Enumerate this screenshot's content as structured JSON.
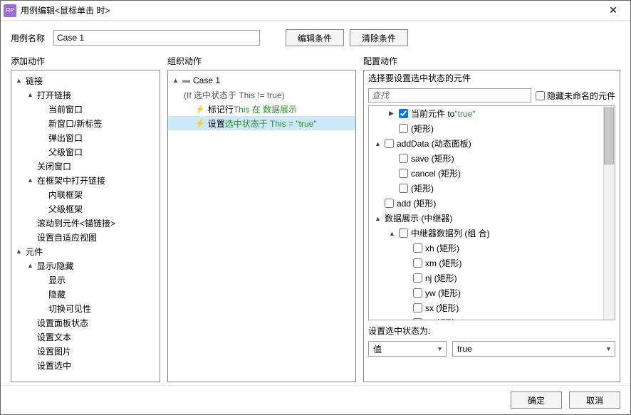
{
  "title": "用例编辑<鼠标单击 时>",
  "caseNameLabel": "用例名称",
  "caseName": "Case 1",
  "btnEditCondition": "编辑条件",
  "btnClearCondition": "清除条件",
  "colAdd": "添加动作",
  "colOrganize": "组织动作",
  "colConfigure": "配置动作",
  "addTree": [
    {
      "label": "链接",
      "level": 0,
      "expanded": true
    },
    {
      "label": "打开链接",
      "level": 1,
      "expanded": true
    },
    {
      "label": "当前窗口",
      "level": 2
    },
    {
      "label": "新窗口/新标签",
      "level": 2
    },
    {
      "label": "弹出窗口",
      "level": 2
    },
    {
      "label": "父级窗口",
      "level": 2
    },
    {
      "label": "关闭窗口",
      "level": 1
    },
    {
      "label": "在框架中打开链接",
      "level": 1,
      "expanded": true
    },
    {
      "label": "内联框架",
      "level": 2
    },
    {
      "label": "父级框架",
      "level": 2
    },
    {
      "label": "滚动到元件<锚链接>",
      "level": 1
    },
    {
      "label": "设置自适应视图",
      "level": 1
    },
    {
      "label": "元件",
      "level": 0,
      "expanded": true
    },
    {
      "label": "显示/隐藏",
      "level": 1,
      "expanded": true
    },
    {
      "label": "显示",
      "level": 2
    },
    {
      "label": "隐藏",
      "level": 2
    },
    {
      "label": "切换可见性",
      "level": 2
    },
    {
      "label": "设置面板状态",
      "level": 1
    },
    {
      "label": "设置文本",
      "level": 1
    },
    {
      "label": "设置图片",
      "level": 1
    },
    {
      "label": "设置选中",
      "level": 1
    }
  ],
  "orgCase": "Case 1",
  "orgCondition": "(If 选中状态于 This != true)",
  "orgAction1_a": "标记行 ",
  "orgAction1_b": "This 在 数据展示",
  "orgAction2_a": "设置 ",
  "orgAction2_b": "选中状态于 This = \"true\"",
  "cfgSelectLabel": "选择要设置选中状态的元件",
  "searchPlaceholder": "查找",
  "hideUnnamed": "隐藏未命名的元件",
  "cfgTree": [
    {
      "label_a": "当前元件 to ",
      "label_b": "\"true\"",
      "level": 1,
      "checked": true,
      "expanded": false
    },
    {
      "label_a": "(矩形)",
      "level": 1
    },
    {
      "label_a": "addData (动态面板)",
      "level": 0,
      "expanded": true
    },
    {
      "label_a": "save (矩形)",
      "level": 1
    },
    {
      "label_a": "cancel (矩形)",
      "level": 1
    },
    {
      "label_a": "(矩形)",
      "level": 1
    },
    {
      "label_a": "add (矩形)",
      "level": 0
    },
    {
      "label_a": "数据展示 (中继器)",
      "level": 0,
      "expanded": true,
      "noCheck": true
    },
    {
      "label_a": "中继器数据列 (组 合)",
      "level": 1,
      "expanded": true
    },
    {
      "label_a": "xh (矩形)",
      "level": 2
    },
    {
      "label_a": "xm (矩形)",
      "level": 2
    },
    {
      "label_a": "nj (矩形)",
      "level": 2
    },
    {
      "label_a": "yw (矩形)",
      "level": 2
    },
    {
      "label_a": "sx (矩形)",
      "level": 2
    },
    {
      "label_a": "zf (矩形)",
      "level": 2
    }
  ],
  "setStateLabel": "设置选中状态为:",
  "valueType": "值",
  "valueText": "true",
  "btnOk": "确定",
  "btnCancel": "取消"
}
